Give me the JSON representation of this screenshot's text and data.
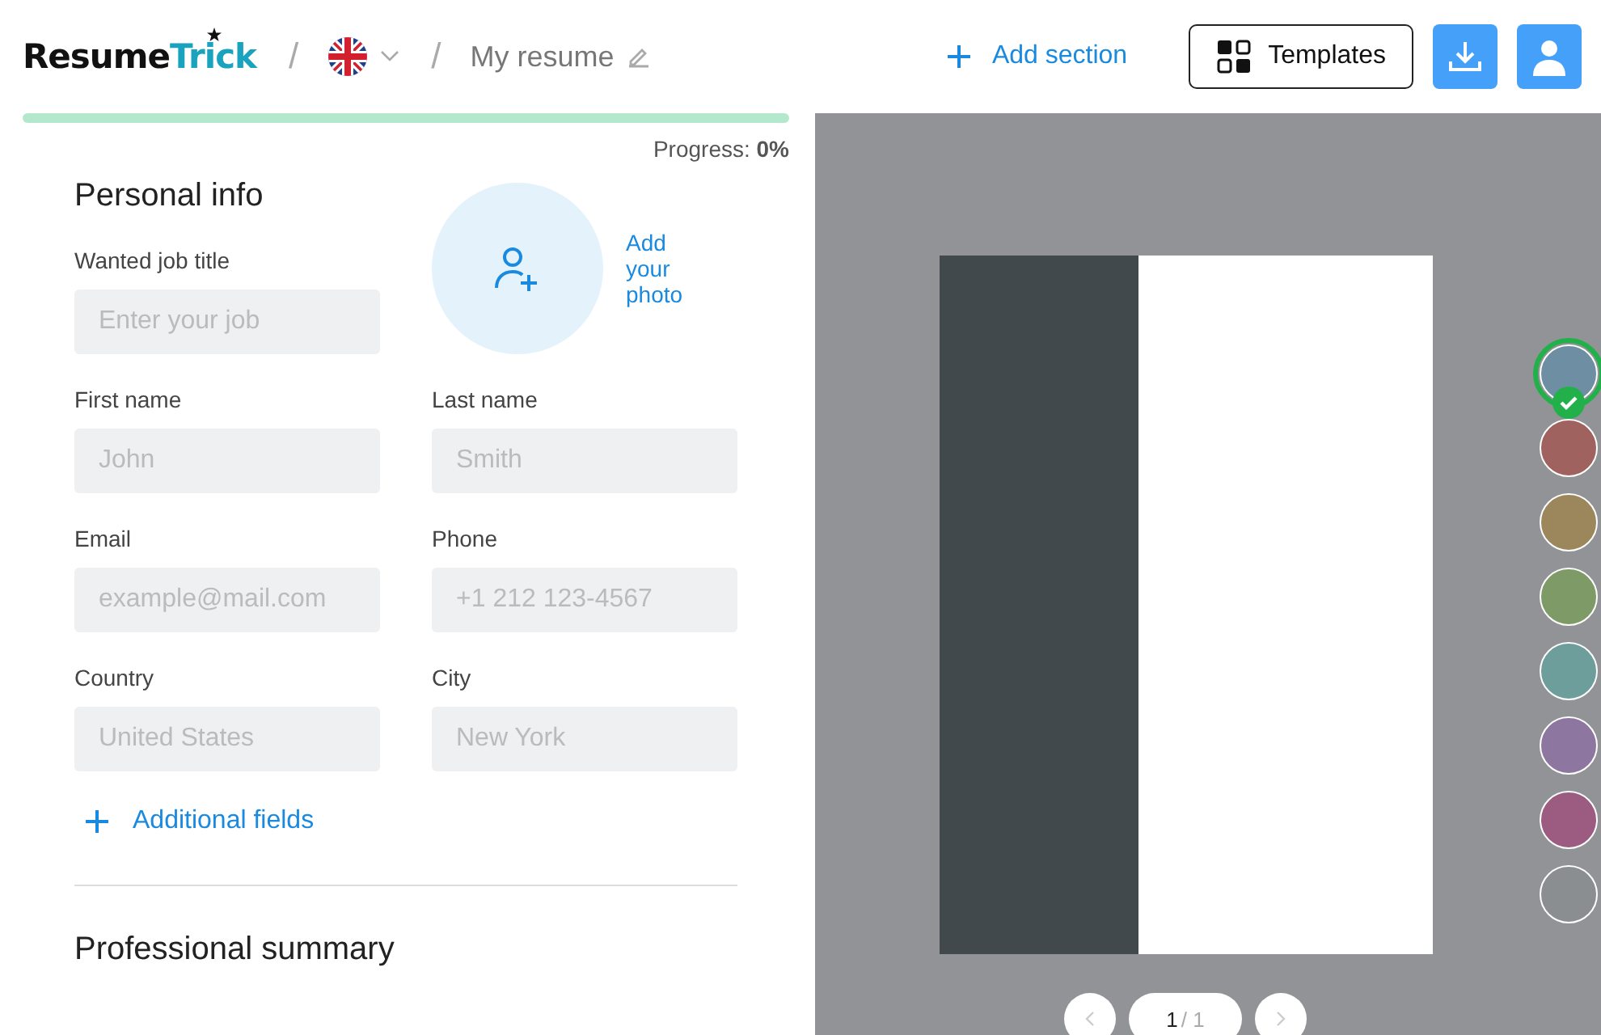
{
  "header": {
    "logo": {
      "first": "Resume",
      "second": "Trick"
    },
    "separator_1": "/",
    "separator_2": "/",
    "document_title": "My resume",
    "add_section": "Add section",
    "templates": "Templates"
  },
  "progress": {
    "level": 0,
    "label": "Progress:",
    "value": "0%"
  },
  "personal_info": {
    "title": "Personal info",
    "photo_label": "Add your photo",
    "fields": [
      {
        "label": "Wanted job title",
        "placeholder": "Enter your job"
      },
      {
        "label": "First name",
        "placeholder": "John"
      },
      {
        "label": "Last name",
        "placeholder": "Smith"
      },
      {
        "label": "Email",
        "placeholder": "example@mail.com"
      },
      {
        "label": "Phone",
        "placeholder": "+1 212 123-4567"
      },
      {
        "label": "Country",
        "placeholder": "United States"
      },
      {
        "label": "City",
        "placeholder": "New York"
      }
    ],
    "additional_fields": "Additional fields"
  },
  "professional_summary": {
    "title": "Professional summary"
  },
  "preview": {
    "page_current": "1",
    "page_total": "/ 1"
  },
  "color_swatches": [
    {
      "color": "#6e8fa3",
      "selected": true
    },
    {
      "color": "#a0625f",
      "selected": false
    },
    {
      "color": "#9c865c",
      "selected": false
    },
    {
      "color": "#7e9a66",
      "selected": false
    },
    {
      "color": "#6e9e9c",
      "selected": false
    },
    {
      "color": "#8d77a0",
      "selected": false
    },
    {
      "color": "#9c5b80",
      "selected": false
    },
    {
      "color": "#8a8e90",
      "selected": false
    }
  ]
}
